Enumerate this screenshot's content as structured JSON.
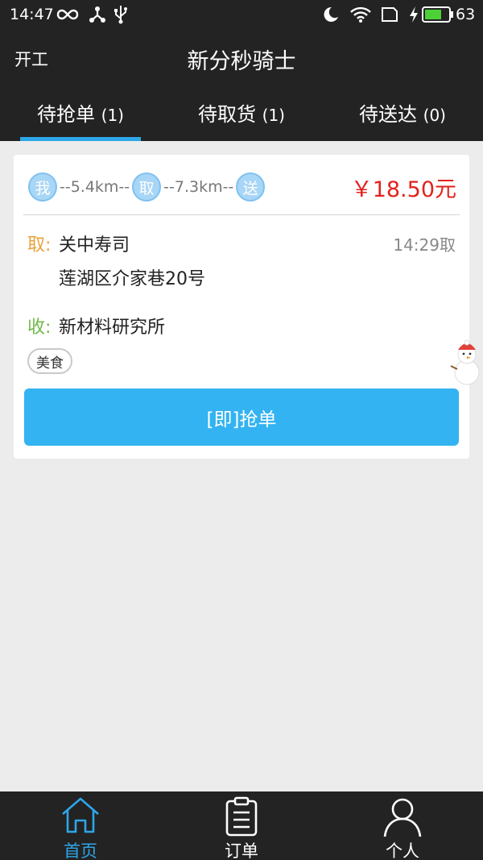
{
  "status_bar": {
    "time": "14:47",
    "battery_percent": "63"
  },
  "header": {
    "start_work_label": "开工",
    "title": "新分秒骑士"
  },
  "tabs": [
    {
      "label": "待抢单",
      "count": "(1)",
      "active": true
    },
    {
      "label": "待取货",
      "count": "(1)",
      "active": false
    },
    {
      "label": "待送达",
      "count": "(0)",
      "active": false
    }
  ],
  "order": {
    "route": {
      "me_badge": "我",
      "dist_to_pickup": "--5.4km--",
      "pickup_badge": "取",
      "dist_to_delivery": "--7.3km--",
      "delivery_badge": "送"
    },
    "price": "￥18.50元",
    "pickup_label": "取:",
    "pickup_name": "关中寿司",
    "pickup_time": "14:29取",
    "pickup_address": "莲湖区介家巷20号",
    "receive_label": "收:",
    "receive_name": "新材料研究所",
    "tag": "美食",
    "grab_button_label": "[即]抢单"
  },
  "bottom_nav": [
    {
      "label": "首页",
      "icon": "home-icon",
      "active": true
    },
    {
      "label": "订单",
      "icon": "clipboard-icon",
      "active": false
    },
    {
      "label": "个人",
      "icon": "person-icon",
      "active": false
    }
  ],
  "colors": {
    "accent": "#2ea6e8",
    "price": "#e2221f",
    "pickup_label": "#e8a33c",
    "receive_label": "#71b849",
    "button": "#33b3f1",
    "dark_bar": "#232323"
  }
}
